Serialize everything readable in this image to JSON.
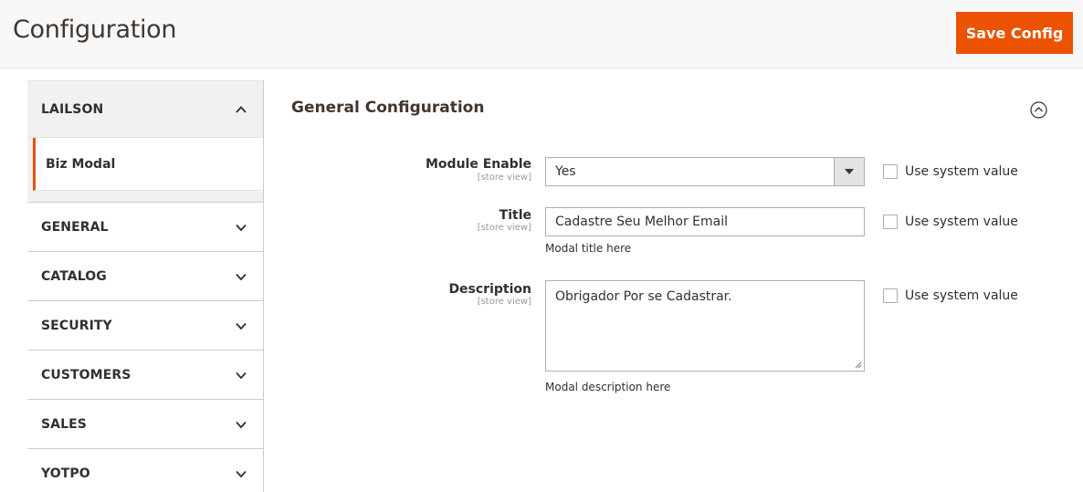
{
  "header": {
    "title": "Configuration",
    "save_label": "Save Config",
    "accent_color": "#eb5202"
  },
  "sidebar": {
    "tabs": [
      {
        "label": "LAILSON",
        "expanded": true,
        "icon": "chevron-up-icon",
        "items": [
          {
            "label": "Biz Modal",
            "active": true
          }
        ]
      },
      {
        "label": "GENERAL",
        "expanded": false,
        "icon": "chevron-down-icon"
      },
      {
        "label": "CATALOG",
        "expanded": false,
        "icon": "chevron-down-icon"
      },
      {
        "label": "SECURITY",
        "expanded": false,
        "icon": "chevron-down-icon"
      },
      {
        "label": "CUSTOMERS",
        "expanded": false,
        "icon": "chevron-down-icon"
      },
      {
        "label": "SALES",
        "expanded": false,
        "icon": "chevron-down-icon"
      },
      {
        "label": "YOTPO",
        "expanded": false,
        "icon": "chevron-down-icon"
      }
    ]
  },
  "section": {
    "title": "General Configuration",
    "collapse_icon": "circle-chevron-up-icon",
    "fields": [
      {
        "label": "Module Enable",
        "scope": "[store view]",
        "type": "select",
        "value": "Yes",
        "use_system_value": "Use system value",
        "system_checked": false
      },
      {
        "label": "Title",
        "scope": "[store view]",
        "type": "text",
        "value": "Cadastre Seu Melhor Email",
        "note": "Modal title here",
        "use_system_value": "Use system value",
        "system_checked": false
      },
      {
        "label": "Description",
        "scope": "[store view]",
        "type": "textarea",
        "value": "Obrigador Por se Cadastrar.",
        "note": "Modal description here",
        "use_system_value": "Use system value",
        "system_checked": false
      }
    ]
  }
}
